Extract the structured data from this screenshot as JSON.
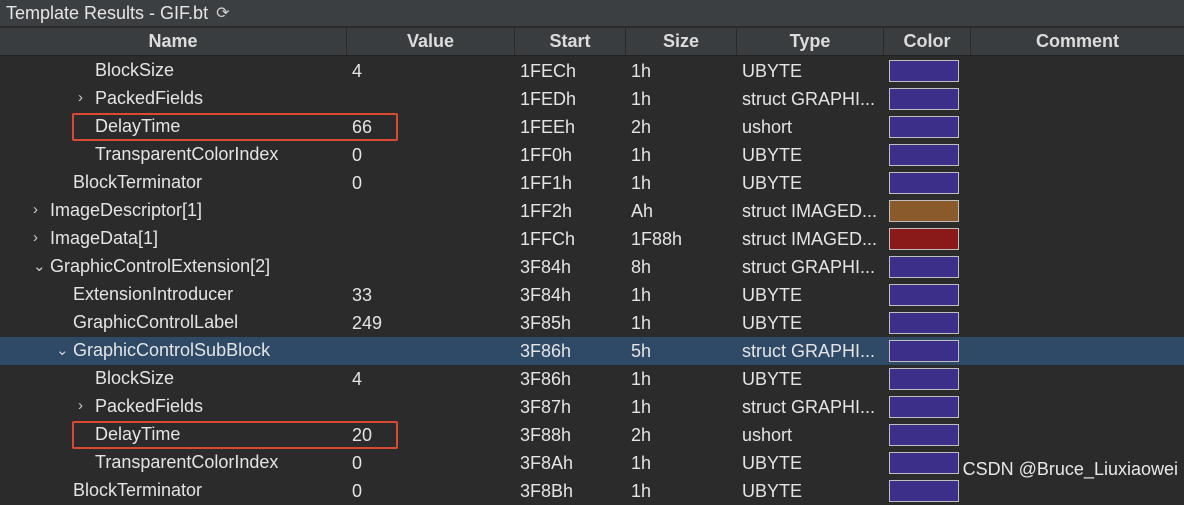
{
  "window": {
    "title": "Template Results - GIF.bt",
    "refresh_icon": "refresh-icon"
  },
  "columns": {
    "name": "Name",
    "value": "Value",
    "start": "Start",
    "size": "Size",
    "type": "Type",
    "color": "Color",
    "comment": "Comment"
  },
  "rows": [
    {
      "name": "BlockSize",
      "value": "4",
      "start": "1FECh",
      "size": "1h",
      "type": "UBYTE",
      "color": "#3b2f8a",
      "indent": 2,
      "expander": "",
      "highlighted": false,
      "selected": false
    },
    {
      "name": "PackedFields",
      "value": "",
      "start": "1FEDh",
      "size": "1h",
      "type": "struct GRAPHI...",
      "color": "#3b2f8a",
      "indent": 2,
      "expander": "›",
      "highlighted": false,
      "selected": false
    },
    {
      "name": "DelayTime",
      "value": "66",
      "start": "1FEEh",
      "size": "2h",
      "type": "ushort",
      "color": "#3b2f8a",
      "indent": 2,
      "expander": "",
      "highlighted": true,
      "selected": false
    },
    {
      "name": "TransparentColorIndex",
      "value": "0",
      "start": "1FF0h",
      "size": "1h",
      "type": "UBYTE",
      "color": "#3b2f8a",
      "indent": 2,
      "expander": "",
      "highlighted": false,
      "selected": false
    },
    {
      "name": "BlockTerminator",
      "value": "0",
      "start": "1FF1h",
      "size": "1h",
      "type": "UBYTE",
      "color": "#3b2f8a",
      "indent": 1,
      "expander": "",
      "highlighted": false,
      "selected": false
    },
    {
      "name": "ImageDescriptor[1]",
      "value": "",
      "start": "1FF2h",
      "size": "Ah",
      "type": "struct IMAGED...",
      "color": "#8a5a2a",
      "indent": 0,
      "expander": "›",
      "highlighted": false,
      "selected": false
    },
    {
      "name": "ImageData[1]",
      "value": "",
      "start": "1FFCh",
      "size": "1F88h",
      "type": "struct IMAGED...",
      "color": "#8a1a1a",
      "indent": 0,
      "expander": "›",
      "highlighted": false,
      "selected": false
    },
    {
      "name": "GraphicControlExtension[2]",
      "value": "",
      "start": "3F84h",
      "size": "8h",
      "type": "struct GRAPHI...",
      "color": "#3b2f8a",
      "indent": 0,
      "expander": "⌄",
      "highlighted": false,
      "selected": false
    },
    {
      "name": "ExtensionIntroducer",
      "value": "33",
      "start": "3F84h",
      "size": "1h",
      "type": "UBYTE",
      "color": "#3b2f8a",
      "indent": 1,
      "expander": "",
      "highlighted": false,
      "selected": false
    },
    {
      "name": "GraphicControlLabel",
      "value": "249",
      "start": "3F85h",
      "size": "1h",
      "type": "UBYTE",
      "color": "#3b2f8a",
      "indent": 1,
      "expander": "",
      "highlighted": false,
      "selected": false
    },
    {
      "name": "GraphicControlSubBlock",
      "value": "",
      "start": "3F86h",
      "size": "5h",
      "type": "struct GRAPHI...",
      "color": "#3b2f8a",
      "indent": 1,
      "expander": "⌄",
      "highlighted": false,
      "selected": true
    },
    {
      "name": "BlockSize",
      "value": "4",
      "start": "3F86h",
      "size": "1h",
      "type": "UBYTE",
      "color": "#3b2f8a",
      "indent": 2,
      "expander": "",
      "highlighted": false,
      "selected": false
    },
    {
      "name": "PackedFields",
      "value": "",
      "start": "3F87h",
      "size": "1h",
      "type": "struct GRAPHI...",
      "color": "#3b2f8a",
      "indent": 2,
      "expander": "›",
      "highlighted": false,
      "selected": false
    },
    {
      "name": "DelayTime",
      "value": "20",
      "start": "3F88h",
      "size": "2h",
      "type": "ushort",
      "color": "#3b2f8a",
      "indent": 2,
      "expander": "",
      "highlighted": true,
      "selected": false
    },
    {
      "name": "TransparentColorIndex",
      "value": "0",
      "start": "3F8Ah",
      "size": "1h",
      "type": "UBYTE",
      "color": "#3b2f8a",
      "indent": 2,
      "expander": "",
      "highlighted": false,
      "selected": false
    },
    {
      "name": "BlockTerminator",
      "value": "0",
      "start": "3F8Bh",
      "size": "1h",
      "type": "UBYTE",
      "color": "#3b2f8a",
      "indent": 1,
      "expander": "",
      "highlighted": false,
      "selected": false
    }
  ],
  "watermark": "CSDN @Bruce_Liuxiaowei"
}
